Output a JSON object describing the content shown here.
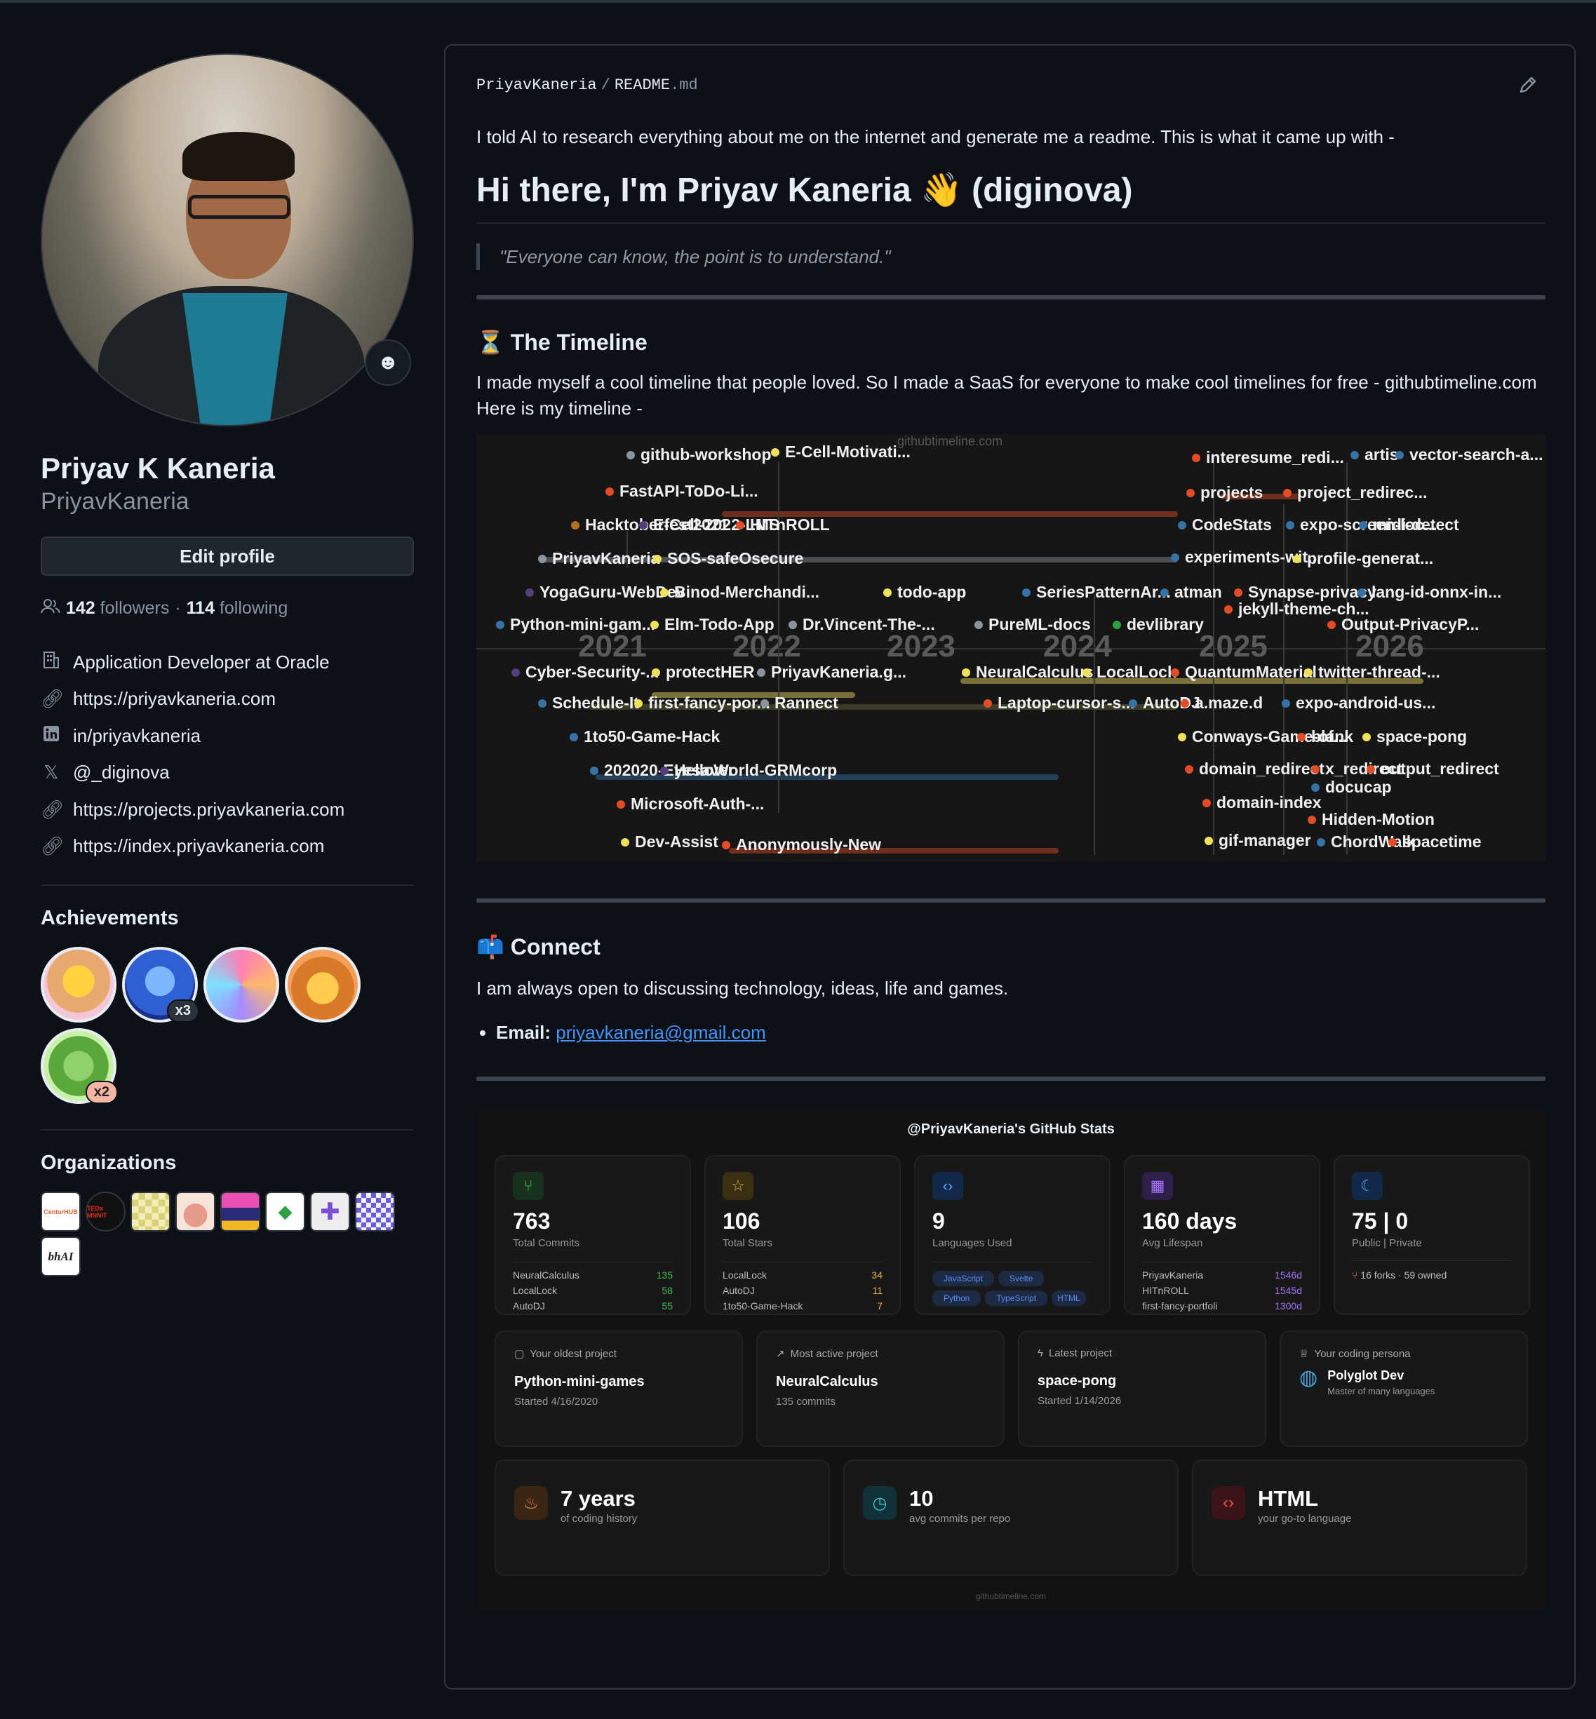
{
  "profile": {
    "name": "Priyav K Kaneria",
    "login": "PriyavKaneria",
    "edit_label": "Edit profile",
    "followers_count": "142",
    "followers_label": "followers",
    "following_count": "114",
    "following_label": "following",
    "details": [
      {
        "icon": "building-icon",
        "text": "Application Developer at Oracle"
      },
      {
        "icon": "link-icon",
        "text": "https://priyavkaneria.com"
      },
      {
        "icon": "linkedin-icon",
        "text": "in/priyavkaneria"
      },
      {
        "icon": "x-icon",
        "text": "@_diginova"
      },
      {
        "icon": "link-icon",
        "text": "https://projects.priyavkaneria.com"
      },
      {
        "icon": "link-icon",
        "text": "https://index.priyavkaneria.com"
      }
    ],
    "achievements_title": "Achievements",
    "achievements": [
      {
        "name": "starstruck-badge",
        "count": ""
      },
      {
        "name": "pull-shark-badge",
        "count": "x3"
      },
      {
        "name": "yolo-badge",
        "count": ""
      },
      {
        "name": "quickdraw-badge",
        "count": ""
      },
      {
        "name": "pair-extraordinaire-badge",
        "count": "x2"
      }
    ],
    "organizations_title": "Organizations",
    "organizations": [
      "CenturHUB",
      "TEDx MNNIT",
      "",
      "",
      "",
      "",
      "",
      "",
      "bhAI"
    ]
  },
  "readme": {
    "owner": "PriyavKaneria",
    "separator": "/",
    "file": "README",
    "ext": ".md",
    "intro": "I told AI to research everything about me on the internet and generate me a readme. This is what it came up with -",
    "heading": "Hi there, I'm Priyav Kaneria 👋 (diginova)",
    "quote": "\"Everyone can know, the point is to understand.\"",
    "timeline_title": "⏳ The Timeline",
    "timeline_text_1": "I made myself a cool timeline that people loved. So I made a SaaS for everyone to make cool timelines for free - githubtimeline.com",
    "timeline_text_2": "Here is my timeline -",
    "connect_title": "📫 Connect",
    "connect_text": "I am always open to discussing technology, ideas, life and games.",
    "email_label": "Email:",
    "email": "priyavkaneria@gmail.com"
  },
  "timeline": {
    "brand": "githubtimeline.com",
    "years": [
      "2021",
      "2022",
      "2023",
      "2024",
      "2025",
      "2026"
    ],
    "projects": [
      {
        "name": "github-workshop",
        "color": "#8b949e"
      },
      {
        "name": "E-Cell-Motivati...",
        "color": "#f1e05a"
      },
      {
        "name": "FastAPI-ToDo-Li...",
        "color": "#e34c26"
      },
      {
        "name": "Hacktoberfest2021",
        "color": "#b07219"
      },
      {
        "name": "E-Cell-2022-LMS",
        "color": "#563d7c"
      },
      {
        "name": "HITnROLL",
        "color": "#e34c26"
      },
      {
        "name": "PriyavKaneria",
        "color": "#8b949e"
      },
      {
        "name": "SOS-safeOsecure",
        "color": "#f1e05a"
      },
      {
        "name": "YogaGuru-WebDev",
        "color": "#563d7c"
      },
      {
        "name": "Binod-Merchandi...",
        "color": "#f1e05a"
      },
      {
        "name": "todo-app",
        "color": "#f1e05a"
      },
      {
        "name": "Python-mini-gam...",
        "color": "#3572A5"
      },
      {
        "name": "Elm-Todo-App",
        "color": "#f1e05a"
      },
      {
        "name": "Dr.Vincent-The-...",
        "color": "#8b949e"
      },
      {
        "name": "PureML-docs",
        "color": "#8b949e"
      },
      {
        "name": "devlibrary",
        "color": "#2ea043"
      },
      {
        "name": "SeriesPatternAr...",
        "color": "#3572A5"
      },
      {
        "name": "atman",
        "color": "#3572A5"
      },
      {
        "name": "Cyber-Security-...",
        "color": "#563d7c"
      },
      {
        "name": "protectHER",
        "color": "#f1e05a"
      },
      {
        "name": "PriyavKaneria.g...",
        "color": "#8b949e"
      },
      {
        "name": "NeuralCalculus",
        "color": "#f1e05a"
      },
      {
        "name": "LocalLock",
        "color": "#f1e05a"
      },
      {
        "name": "Schedule-It",
        "color": "#3572A5"
      },
      {
        "name": "first-fancy-por...",
        "color": "#f1e05a"
      },
      {
        "name": "Rannect",
        "color": "#8b949e"
      },
      {
        "name": "Laptop-cursor-s...",
        "color": "#e34c26"
      },
      {
        "name": "AutoDJ",
        "color": "#3572A5"
      },
      {
        "name": "1to50-Game-Hack",
        "color": "#3572A5"
      },
      {
        "name": "202020-Eyesaver",
        "color": "#3572A5"
      },
      {
        "name": "HelloWorld-GRMcorp",
        "color": "#563d7c"
      },
      {
        "name": "Microsoft-Auth-...",
        "color": "#e34c26"
      },
      {
        "name": "Dev-Assist",
        "color": "#f1e05a"
      },
      {
        "name": "Anonymously-New",
        "color": "#e34c26"
      },
      {
        "name": "interesume_redi...",
        "color": "#e34c26"
      },
      {
        "name": "artis",
        "color": "#3572A5"
      },
      {
        "name": "vector-search-a...",
        "color": "#3572A5"
      },
      {
        "name": "projects",
        "color": "#e34c26"
      },
      {
        "name": "project_redirec...",
        "color": "#e34c26"
      },
      {
        "name": "CodeStats",
        "color": "#3572A5"
      },
      {
        "name": "expo-screen-loc...",
        "color": "#3572A5"
      },
      {
        "name": "midi-detect",
        "color": "#3572A5"
      },
      {
        "name": "experiments-wit...",
        "color": "#3572A5"
      },
      {
        "name": "profile-generat...",
        "color": "#f1e05a"
      },
      {
        "name": "Synapse-privacy",
        "color": "#e34c26"
      },
      {
        "name": "lang-id-onnx-in...",
        "color": "#3572A5"
      },
      {
        "name": "jekyll-theme-ch...",
        "color": "#e34c26"
      },
      {
        "name": "Output-PrivacyP...",
        "color": "#e34c26"
      },
      {
        "name": "QuantumMaterial",
        "color": "#e34c26"
      },
      {
        "name": "twitter-thread-...",
        "color": "#f1e05a"
      },
      {
        "name": "a.maze.d",
        "color": "#e34c26"
      },
      {
        "name": "expo-android-us...",
        "color": "#3572A5"
      },
      {
        "name": "Conways-Game-of...",
        "color": "#f1e05a"
      },
      {
        "name": "blank",
        "color": "#e34c26"
      },
      {
        "name": "space-pong",
        "color": "#f1e05a"
      },
      {
        "name": "domain_redirect",
        "color": "#e34c26"
      },
      {
        "name": "x_redirect",
        "color": "#e34c26"
      },
      {
        "name": "output_redirect",
        "color": "#e34c26"
      },
      {
        "name": "docucap",
        "color": "#3572A5"
      },
      {
        "name": "domain-index",
        "color": "#e34c26"
      },
      {
        "name": "Hidden-Motion",
        "color": "#e34c26"
      },
      {
        "name": "gif-manager",
        "color": "#f1e05a"
      },
      {
        "name": "ChordWalk",
        "color": "#3572A5"
      },
      {
        "name": "spacetime",
        "color": "#e34c26"
      }
    ]
  },
  "stats": {
    "title": "@PriyavKaneria's GitHub Stats",
    "cards": [
      {
        "icon": "git-branch-icon",
        "value": "763",
        "label": "Total Commits",
        "accent": "#3fb950",
        "rows": [
          [
            "NeuralCalculus",
            "135"
          ],
          [
            "LocalLock",
            "58"
          ],
          [
            "AutoDJ",
            "55"
          ]
        ]
      },
      {
        "icon": "star-icon",
        "value": "106",
        "label": "Total Stars",
        "accent": "#e3b341",
        "rows": [
          [
            "LocalLock",
            "34"
          ],
          [
            "AutoDJ",
            "11"
          ],
          [
            "1to50-Game-Hack",
            "7"
          ]
        ]
      },
      {
        "icon": "code-icon",
        "value": "9",
        "label": "Languages Used",
        "accent": "#58a6ff",
        "chips": [
          "JavaScript",
          "Svelte",
          "Python",
          "TypeScript",
          "HTML"
        ]
      },
      {
        "icon": "calendar-icon",
        "value": "160 days",
        "label": "Avg Lifespan",
        "accent": "#a371f7",
        "rows": [
          [
            "PriyavKaneria",
            "1546d"
          ],
          [
            "HITnROLL",
            "1545d"
          ],
          [
            "first-fancy-portfoli",
            "1300d"
          ]
        ]
      },
      {
        "icon": "moon-icon",
        "value": "75 | 0",
        "label": "Public | Private",
        "accent": "#58a6ff",
        "forks": "16 forks · 59 owned"
      }
    ],
    "mid": [
      {
        "icon": "calendar-icon",
        "head": "Your oldest project",
        "title": "Python-mini-games",
        "sub": "Started 4/16/2020"
      },
      {
        "icon": "trending-up-icon",
        "head": "Most active project",
        "title": "NeuralCalculus",
        "sub": "135 commits"
      },
      {
        "icon": "zap-icon",
        "head": "Latest project",
        "title": "space-pong",
        "sub": "Started 1/14/2026"
      },
      {
        "icon": "trophy-icon",
        "head": "Your coding persona",
        "title": "Polyglot Dev",
        "sub": "Master of many languages"
      }
    ],
    "bottom": [
      {
        "icon": "flame-icon",
        "value": "7 years",
        "sub": "of coding history",
        "accent": "#f0883e"
      },
      {
        "icon": "clock-icon",
        "value": "10",
        "sub": "avg commits per repo",
        "accent": "#39c5cf"
      },
      {
        "icon": "code-icon",
        "value": "HTML",
        "sub": "your go-to language",
        "accent": "#f85149"
      }
    ],
    "footer": "githubtimeline.com"
  }
}
